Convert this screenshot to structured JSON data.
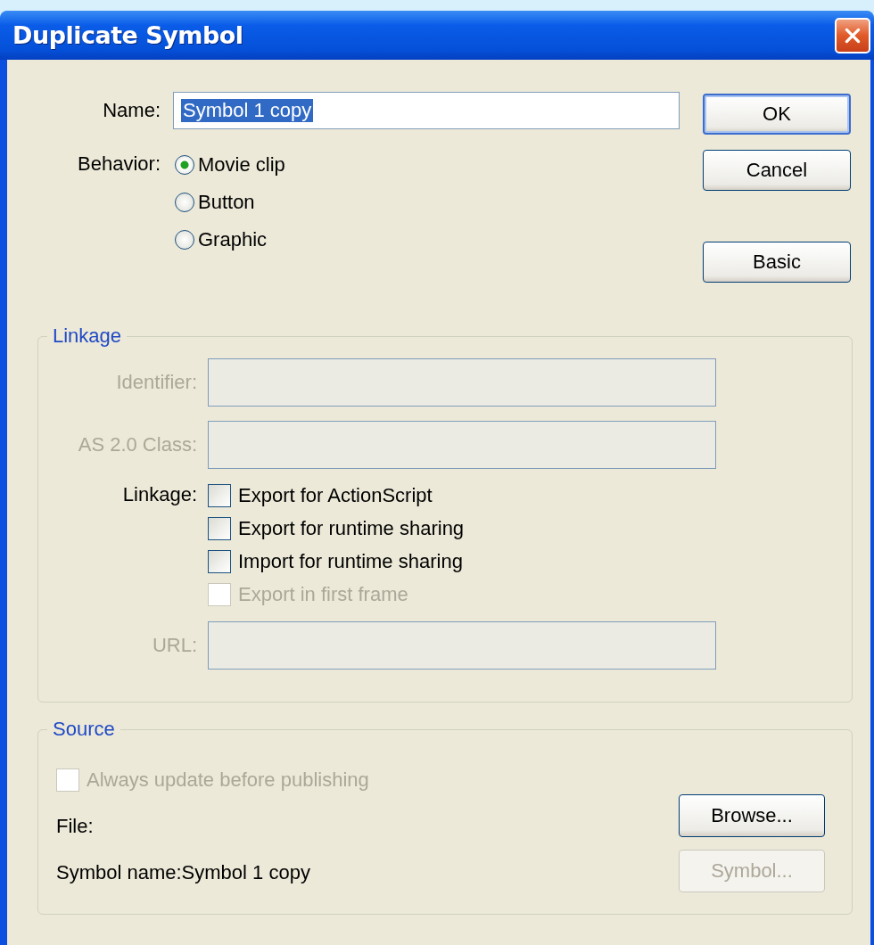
{
  "window": {
    "title": "Duplicate Symbol"
  },
  "name_field": {
    "label": "Name:",
    "value": "Symbol 1 copy",
    "highlighted": true
  },
  "behavior": {
    "label": "Behavior:",
    "options": [
      {
        "label": "Movie clip",
        "selected": true
      },
      {
        "label": "Button",
        "selected": false
      },
      {
        "label": "Graphic",
        "selected": false
      }
    ]
  },
  "buttons": [
    {
      "label": "OK",
      "default": true
    },
    {
      "label": "Cancel",
      "default": false
    },
    {
      "label": "Basic",
      "default": false
    }
  ],
  "linkage": {
    "title": "Linkage",
    "fields": [
      {
        "label": "Identifier:",
        "disabled": true
      },
      {
        "label": "AS 2.0 Class:",
        "disabled": true
      }
    ],
    "options_label": "Linkage:",
    "options": [
      {
        "label": "Export for ActionScript",
        "checked": false,
        "disabled": false
      },
      {
        "label": "Export for runtime sharing",
        "checked": false,
        "disabled": false
      },
      {
        "label": "Import for runtime sharing",
        "checked": false,
        "disabled": false
      },
      {
        "label": "Export in first frame",
        "checked": false,
        "disabled": true
      }
    ],
    "url": {
      "label": "URL:",
      "disabled": true
    }
  },
  "source": {
    "title": "Source",
    "always_update": {
      "label": "Always update before publishing",
      "checked": false,
      "disabled": true
    },
    "file_label": "File:",
    "symbol_name": "Symbol name:Symbol 1 copy",
    "buttons": [
      {
        "label": "Browse...",
        "disabled": false
      },
      {
        "label": "Symbol...",
        "disabled": true
      }
    ]
  }
}
